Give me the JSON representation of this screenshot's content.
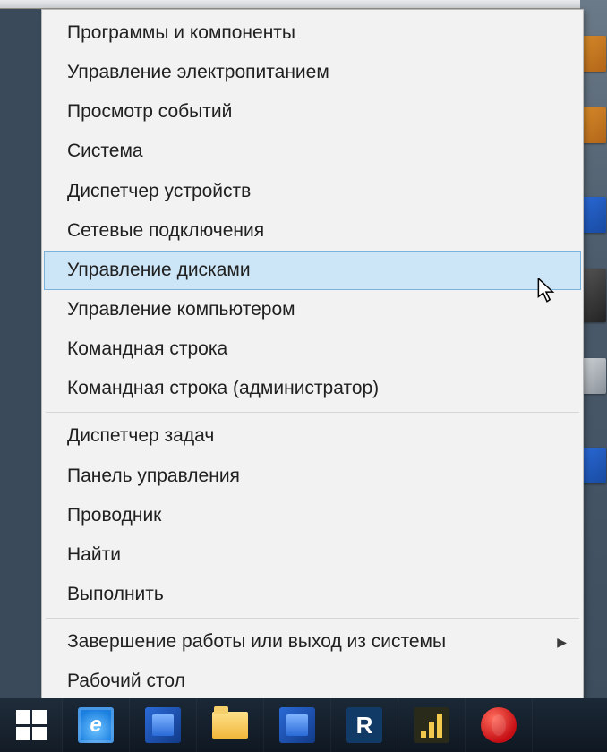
{
  "menu": {
    "groups": [
      [
        {
          "id": "programs-and-features",
          "label": "Программы и компоненты"
        },
        {
          "id": "power-options",
          "label": "Управление электропитанием"
        },
        {
          "id": "event-viewer",
          "label": "Просмотр событий"
        },
        {
          "id": "system",
          "label": "Система"
        },
        {
          "id": "device-manager",
          "label": "Диспетчер устройств"
        },
        {
          "id": "network-connections",
          "label": "Сетевые подключения"
        },
        {
          "id": "disk-management",
          "label": "Управление дисками",
          "hover": true
        },
        {
          "id": "computer-management",
          "label": "Управление компьютером"
        },
        {
          "id": "command-prompt",
          "label": "Командная строка"
        },
        {
          "id": "command-prompt-admin",
          "label": "Командная строка (администратор)"
        }
      ],
      [
        {
          "id": "task-manager",
          "label": "Диспетчер задач"
        },
        {
          "id": "control-panel",
          "label": "Панель управления"
        },
        {
          "id": "explorer",
          "label": "Проводник"
        },
        {
          "id": "search",
          "label": "Найти"
        },
        {
          "id": "run",
          "label": "Выполнить"
        }
      ],
      [
        {
          "id": "shutdown-signout",
          "label": "Завершение работы или выход из системы",
          "submenu": true
        },
        {
          "id": "desktop",
          "label": "Рабочий стол"
        }
      ]
    ]
  },
  "taskbar": {
    "buttons": [
      {
        "id": "start",
        "icon": "windows-logo"
      },
      {
        "id": "ie",
        "icon": "internet-explorer"
      },
      {
        "id": "generic-blue",
        "icon": "blue-square"
      },
      {
        "id": "explorer",
        "icon": "folder"
      },
      {
        "id": "word-like",
        "icon": "blue-square"
      },
      {
        "id": "r-app",
        "icon": "letter-r"
      },
      {
        "id": "equalizer",
        "icon": "bars"
      },
      {
        "id": "opera",
        "icon": "opera"
      }
    ]
  }
}
